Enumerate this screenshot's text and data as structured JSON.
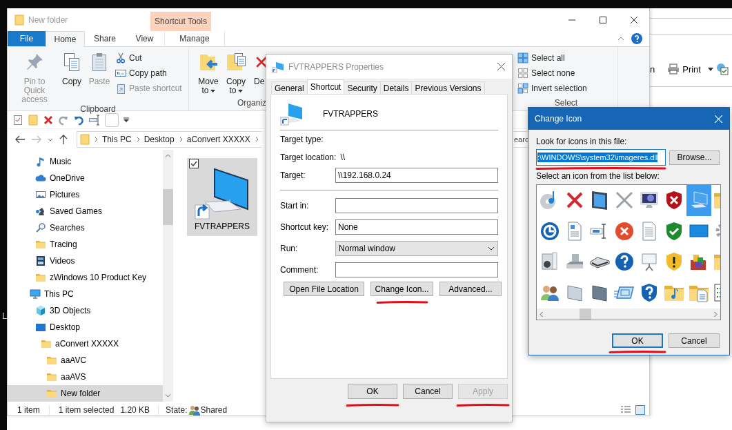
{
  "desktop": {
    "left_edge_text": "L"
  },
  "background_window": {
    "cut_text": "n",
    "print_label": "Print"
  },
  "explorer": {
    "title": "New folder",
    "contextual_header": "Shortcut Tools",
    "tabs": [
      {
        "label": "File",
        "kind": "file",
        "selected": false
      },
      {
        "label": "Home",
        "kind": "tab",
        "selected": true
      },
      {
        "label": "Share",
        "kind": "tab",
        "selected": false
      },
      {
        "label": "View",
        "kind": "tab",
        "selected": false
      },
      {
        "label": "Manage",
        "kind": "contextual",
        "selected": false
      }
    ],
    "ribbon_groups": [
      {
        "label": "Clipboard",
        "kind": "clipboard",
        "large": [
          {
            "label": "Pin to Quick access",
            "kind": "pin",
            "disabled": true
          },
          {
            "label": "Copy",
            "kind": "copy",
            "disabled": false
          },
          {
            "label": "Paste",
            "kind": "paste",
            "disabled": true
          }
        ],
        "small": [
          {
            "label": "Cut",
            "kind": "cut",
            "disabled": false
          },
          {
            "label": "Copy path",
            "kind": "copy-path",
            "disabled": false
          },
          {
            "label": "Paste shortcut",
            "kind": "paste-shortcut",
            "disabled": true
          }
        ]
      },
      {
        "label": "Organiz",
        "kind": "organize",
        "large": [
          {
            "label": "Move to",
            "kind": "move-to",
            "disabled": false,
            "dropdown": true
          },
          {
            "label": "Copy to",
            "kind": "copy-to",
            "disabled": false,
            "dropdown": true
          },
          {
            "label": "De",
            "kind": "delete",
            "disabled": false,
            "dropdown": false
          }
        ]
      },
      {
        "label": "Select",
        "kind": "select",
        "small": [
          {
            "label": "Select all",
            "kind": "select-all",
            "disabled": false
          },
          {
            "label": "Select none",
            "kind": "select-none",
            "disabled": false
          },
          {
            "label": "Invert selection",
            "kind": "invert",
            "disabled": false
          }
        ]
      }
    ],
    "address": {
      "crumbs": [
        "This PC",
        "Desktop",
        "aConvert XXXXX"
      ],
      "search_placeholder": "earc"
    },
    "nav_pane": {
      "quick_items": [
        {
          "label": "Music",
          "kind": "music",
          "selected": false
        },
        {
          "label": "OneDrive",
          "kind": "cloud",
          "selected": false
        },
        {
          "label": "Pictures",
          "kind": "pictures",
          "selected": false
        },
        {
          "label": "Saved Games",
          "kind": "games",
          "selected": false
        },
        {
          "label": "Searches",
          "kind": "search",
          "selected": false
        },
        {
          "label": "Tracing",
          "kind": "folder",
          "selected": false
        },
        {
          "label": "Videos",
          "kind": "videos",
          "selected": false
        },
        {
          "label": "zWindows 10 Product Key",
          "kind": "folder",
          "selected": false
        }
      ],
      "tree": [
        {
          "label": "This PC",
          "kind": "pc",
          "selected": false,
          "children": [
            {
              "label": "3D Objects",
              "kind": "cube",
              "selected": false
            },
            {
              "label": "Desktop",
              "kind": "desktop",
              "selected": false,
              "children": [
                {
                  "label": "aConvert XXXXX",
                  "kind": "folder",
                  "selected": false,
                  "children": [
                    {
                      "label": "aaAVC",
                      "kind": "folder",
                      "selected": false
                    },
                    {
                      "label": "aaAVS",
                      "kind": "folder",
                      "selected": false
                    },
                    {
                      "label": "New folder",
                      "kind": "folder",
                      "selected": true
                    }
                  ]
                }
              ]
            }
          ]
        }
      ]
    },
    "items": [
      {
        "label": "FVTRAPPERS",
        "selected": true,
        "checked": true
      }
    ],
    "status_bar": {
      "count": "1 item",
      "selection": "1 item selected",
      "size": "1.20 KB",
      "state_label": "State:",
      "state_value": "Shared"
    }
  },
  "properties_dialog": {
    "title": "FVTRAPPERS Properties",
    "tabs": [
      {
        "label": "General",
        "selected": false
      },
      {
        "label": "Shortcut",
        "selected": true
      },
      {
        "label": "Security",
        "selected": false
      },
      {
        "label": "Details",
        "selected": false
      },
      {
        "label": "Previous Versions",
        "selected": false
      }
    ],
    "name": "FVTRAPPERS",
    "target_rows": [
      {
        "label": "Target type:",
        "kind": "text"
      },
      {
        "label": "Target location:",
        "kind": "text",
        "value": "\\\\"
      },
      {
        "label": "Target:",
        "kind": "input",
        "value": "\\\\192.168.0.24"
      }
    ],
    "option_rows": [
      {
        "label": "Start in:",
        "kind": "input"
      },
      {
        "label": "Shortcut key:",
        "kind": "input",
        "value": "None"
      },
      {
        "label": "Run:",
        "kind": "select",
        "value": "Normal window"
      },
      {
        "label": "Comment:",
        "kind": "input"
      }
    ],
    "actions": [
      {
        "label": "Open File Location",
        "annotated": false
      },
      {
        "label": "Change Icon...",
        "annotated": true
      },
      {
        "label": "Advanced...",
        "annotated": false
      }
    ],
    "buttons": [
      {
        "label": "OK",
        "disabled": false,
        "annotated": true
      },
      {
        "label": "Cancel",
        "disabled": false,
        "annotated": false
      },
      {
        "label": "Apply",
        "disabled": true,
        "annotated": true
      }
    ]
  },
  "change_icon_dialog": {
    "title": "Change Icon",
    "file_label": "Look for icons in this file:",
    "file_value": ":\\WINDOWS\\system32\\imageres.dll",
    "file_text_selected": true,
    "file_annotated": true,
    "browse": "Browse...",
    "list_label": "Select an icon from the list below:",
    "icons": [
      {
        "kind": "disc-music",
        "selected": false
      },
      {
        "kind": "red-x",
        "selected": false
      },
      {
        "kind": "device",
        "selected": false
      },
      {
        "kind": "small-x",
        "selected": false
      },
      {
        "kind": "crt-monitor",
        "selected": false
      },
      {
        "kind": "shield-x",
        "selected": false
      },
      {
        "kind": "computer",
        "selected": true
      },
      {
        "kind": "folder",
        "selected": false
      },
      {
        "kind": "clock-arrow",
        "selected": false
      },
      {
        "kind": "doc-picture",
        "selected": false
      },
      {
        "kind": "text-field",
        "selected": false
      },
      {
        "kind": "circle-x",
        "selected": false
      },
      {
        "kind": "document",
        "selected": false
      },
      {
        "kind": "shield-check",
        "selected": false
      },
      {
        "kind": "screen",
        "selected": false
      },
      {
        "kind": "gear",
        "selected": false
      },
      {
        "kind": "media",
        "selected": false
      },
      {
        "kind": "drive",
        "selected": false
      },
      {
        "kind": "scanner",
        "selected": false
      },
      {
        "kind": "question-circle",
        "selected": false
      },
      {
        "kind": "projector",
        "selected": false
      },
      {
        "kind": "shield-warning",
        "selected": false
      },
      {
        "kind": "blocks",
        "selected": false
      },
      {
        "kind": "folder",
        "selected": false
      },
      {
        "kind": "users",
        "selected": false
      },
      {
        "kind": "panel-light",
        "selected": false
      },
      {
        "kind": "panel-dark",
        "selected": false
      },
      {
        "kind": "screen-lines",
        "selected": false
      },
      {
        "kind": "shield-question",
        "selected": false
      },
      {
        "kind": "music-folder",
        "selected": false
      },
      {
        "kind": "doc-folder",
        "selected": false
      },
      {
        "kind": "list",
        "selected": false
      }
    ],
    "buttons": [
      {
        "label": "OK",
        "default": true,
        "annotated": true
      },
      {
        "label": "Cancel",
        "default": false,
        "annotated": false
      }
    ]
  }
}
